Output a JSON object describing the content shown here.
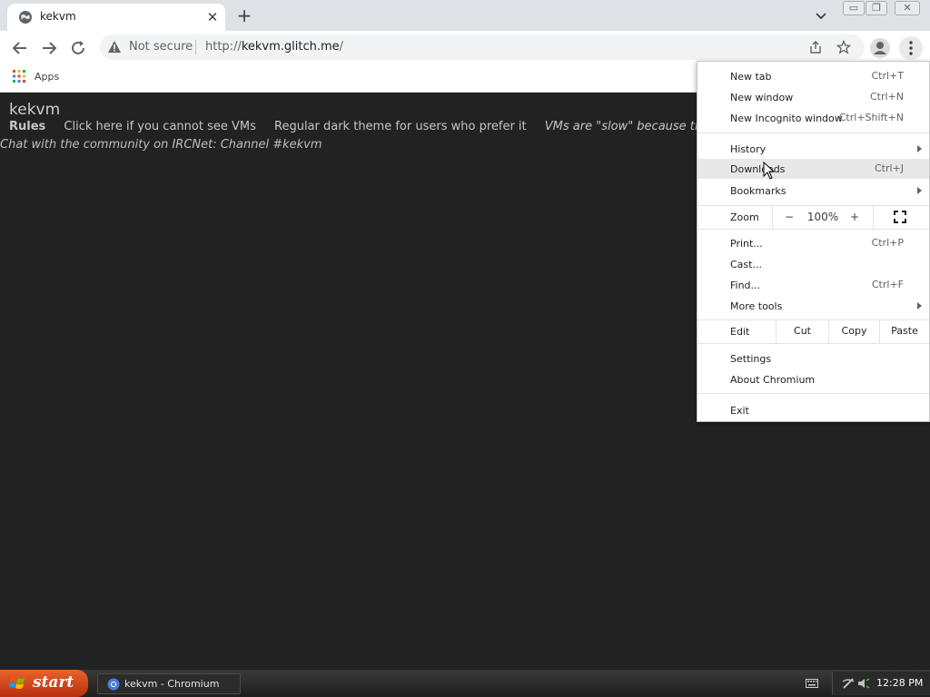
{
  "tab": {
    "title": "kekvm",
    "close_glyph": "✕",
    "new_tab_glyph": "+"
  },
  "window_buttons": {
    "minimize": "▭",
    "restore": "❐",
    "close": "✕"
  },
  "toolbar": {
    "security_label": "Not secure",
    "url_prefix": "http://",
    "url_host": "kekvm.glitch.me",
    "url_suffix": "/"
  },
  "bookmarks": {
    "apps_label": "Apps"
  },
  "page": {
    "title": "kekvm",
    "rules": "Rules",
    "cannot_see": "Click here if you cannot see VMs",
    "dark_theme": "Regular dark theme for users who prefer it",
    "slow_note": "VMs are \"slow\" because the server i",
    "chat": "Chat with the community on IRCNet: Channel #kekvm"
  },
  "menu": {
    "new_tab": {
      "label": "New tab",
      "shortcut": "Ctrl+T"
    },
    "new_window": {
      "label": "New window",
      "shortcut": "Ctrl+N"
    },
    "incognito": {
      "label": "New Incognito window",
      "shortcut": "Ctrl+Shift+N"
    },
    "history": {
      "label": "History"
    },
    "downloads": {
      "label": "Downloads",
      "shortcut": "Ctrl+J"
    },
    "bookmarks": {
      "label": "Bookmarks"
    },
    "zoom": {
      "label": "Zoom",
      "minus": "−",
      "value": "100%",
      "plus": "+"
    },
    "print": {
      "label": "Print...",
      "shortcut": "Ctrl+P"
    },
    "cast": {
      "label": "Cast..."
    },
    "find": {
      "label": "Find...",
      "shortcut": "Ctrl+F"
    },
    "more_tools": {
      "label": "More tools"
    },
    "edit": {
      "label": "Edit",
      "cut": "Cut",
      "copy": "Copy",
      "paste": "Paste"
    },
    "settings": {
      "label": "Settings"
    },
    "about": {
      "label": "About Chromium"
    },
    "exit": {
      "label": "Exit"
    }
  },
  "taskbar": {
    "start_label": "start",
    "task_label": "kekvm - Chromium",
    "clock": "12:28 PM"
  },
  "colors": {
    "page_bg": "#222222",
    "tabstrip_bg": "#dee1e6",
    "menu_highlight": "#e8e8e8",
    "start_button": "#d6491f"
  }
}
